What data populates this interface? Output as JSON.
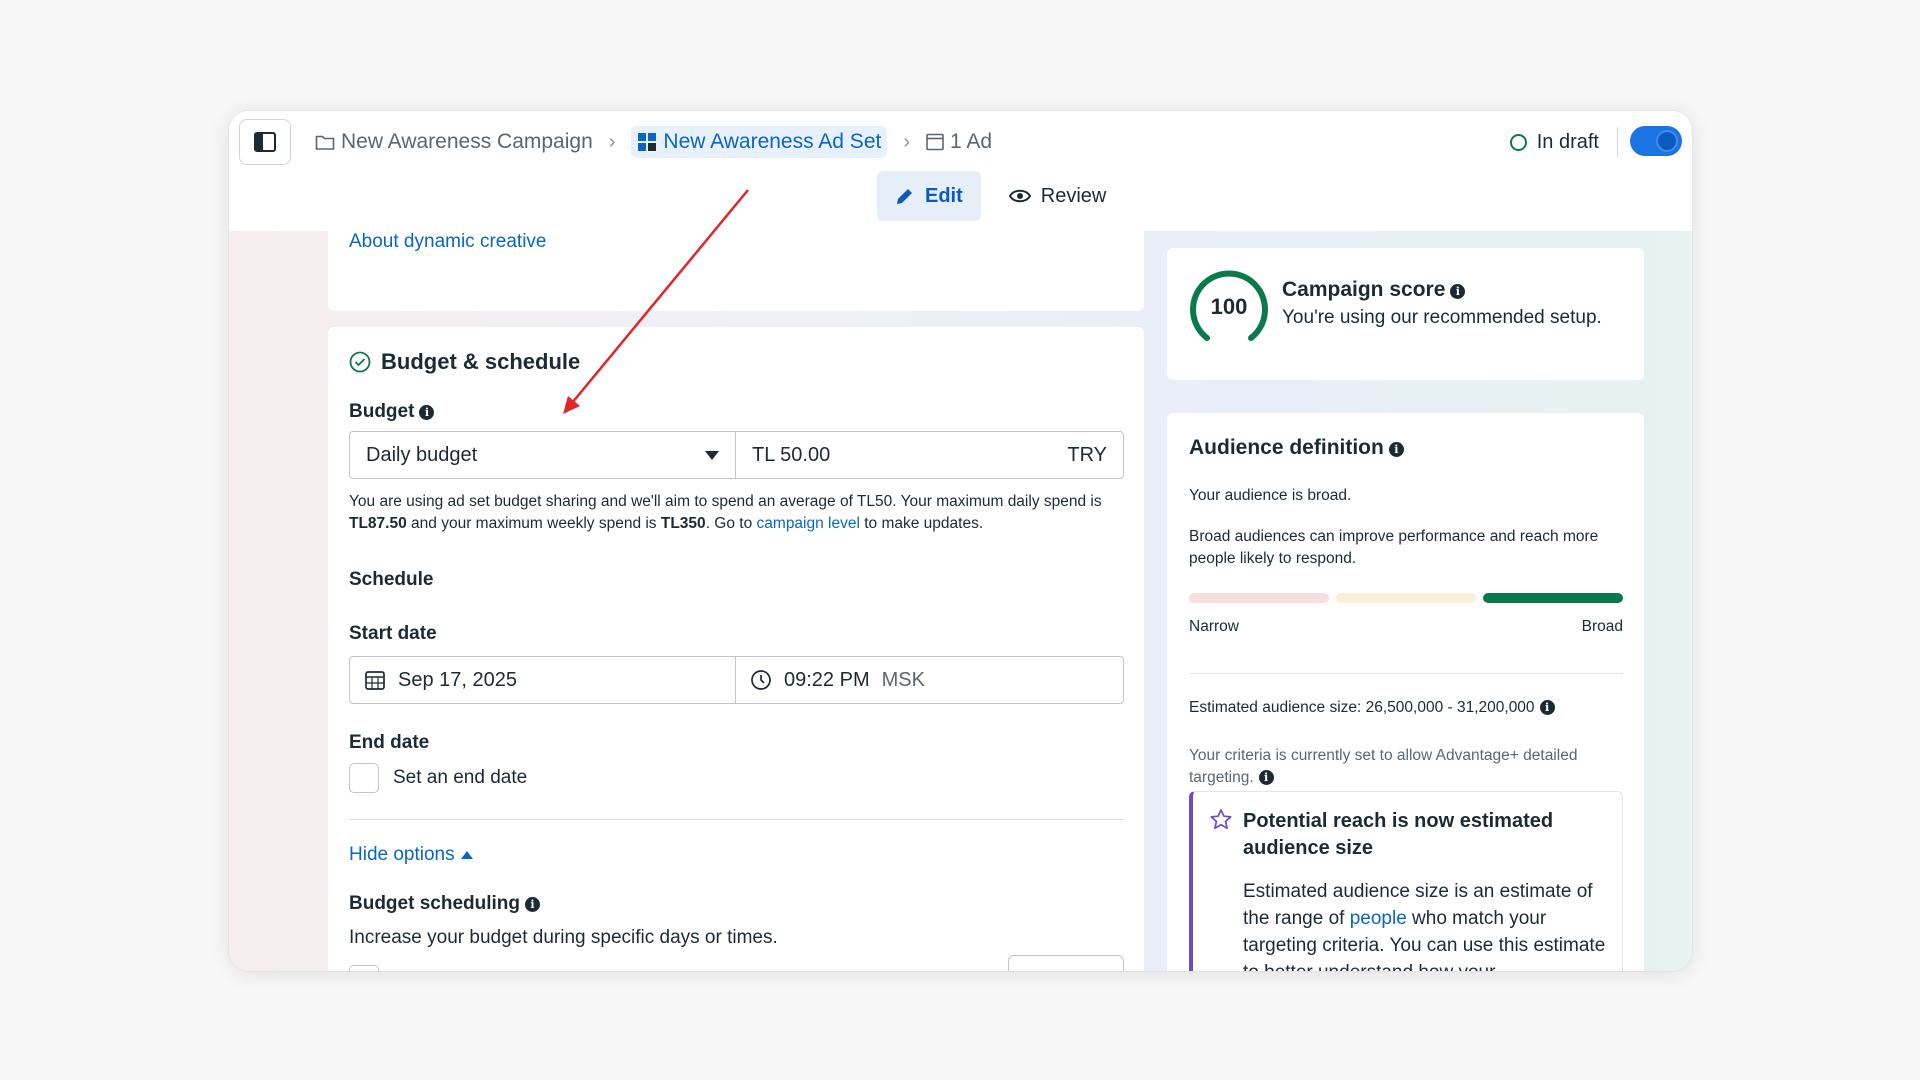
{
  "header": {
    "breadcrumbs": [
      {
        "label": "New Awareness Campaign",
        "icon": "folder-icon"
      },
      {
        "label": "New Awareness Ad Set",
        "icon": "ad-set-grid-icon"
      },
      {
        "label": "1 Ad",
        "icon": "ad-icon"
      }
    ],
    "status": "In draft",
    "tabs": {
      "edit": "Edit",
      "review": "Review"
    }
  },
  "main": {
    "about_link": "About dynamic creative",
    "budget_schedule": {
      "title": "Budget & schedule",
      "budget_label": "Budget",
      "budget_type": "Daily budget",
      "amount": "TL 50.00",
      "currency": "TRY",
      "note_part1": "You are using ad set budget sharing and we'll aim to spend an average of TL50. Your maximum daily spend is ",
      "note_daily_max": "TL87.50",
      "note_part2": " and your maximum weekly spend is ",
      "note_weekly_max": "TL350",
      "note_part3": ". Go to ",
      "note_link": "campaign level",
      "note_part4": " to make updates.",
      "schedule_label": "Schedule",
      "start_date_label": "Start date",
      "start_date": "Sep 17, 2025",
      "start_time": "09:22 PM",
      "timezone": "MSK",
      "end_date_label": "End date",
      "end_date_checkbox": "Set an end date",
      "hide_options": "Hide options",
      "budget_scheduling_label": "Budget scheduling",
      "budget_scheduling_desc": "Increase your budget during specific days or times."
    }
  },
  "side": {
    "campaign_score": {
      "value": "100",
      "title": "Campaign score",
      "desc": "You're using our recommended setup."
    },
    "audience": {
      "title": "Audience definition",
      "broad_text": "Your audience is broad.",
      "desc": "Broad audiences can improve performance and reach more people likely to respond.",
      "narrow_label": "Narrow",
      "broad_label": "Broad",
      "meter_level": "broad",
      "estimated_size": "Estimated audience size: 26,500,000 - 31,200,000",
      "criteria": "Your criteria is currently set to allow Advantage+ detailed targeting.",
      "notice_title": "Potential reach is now estimated audience size",
      "notice_body_1": "Estimated audience size is an estimate of the range of ",
      "notice_link": "people",
      "notice_body_2": " who match your targeting criteria. You can use this estimate to better understand how your"
    }
  },
  "colors": {
    "accent": "#0a66c2",
    "success": "#0b7a4b",
    "annotation_arrow": "#e0262b",
    "notice_border": "#6c4bd1"
  }
}
